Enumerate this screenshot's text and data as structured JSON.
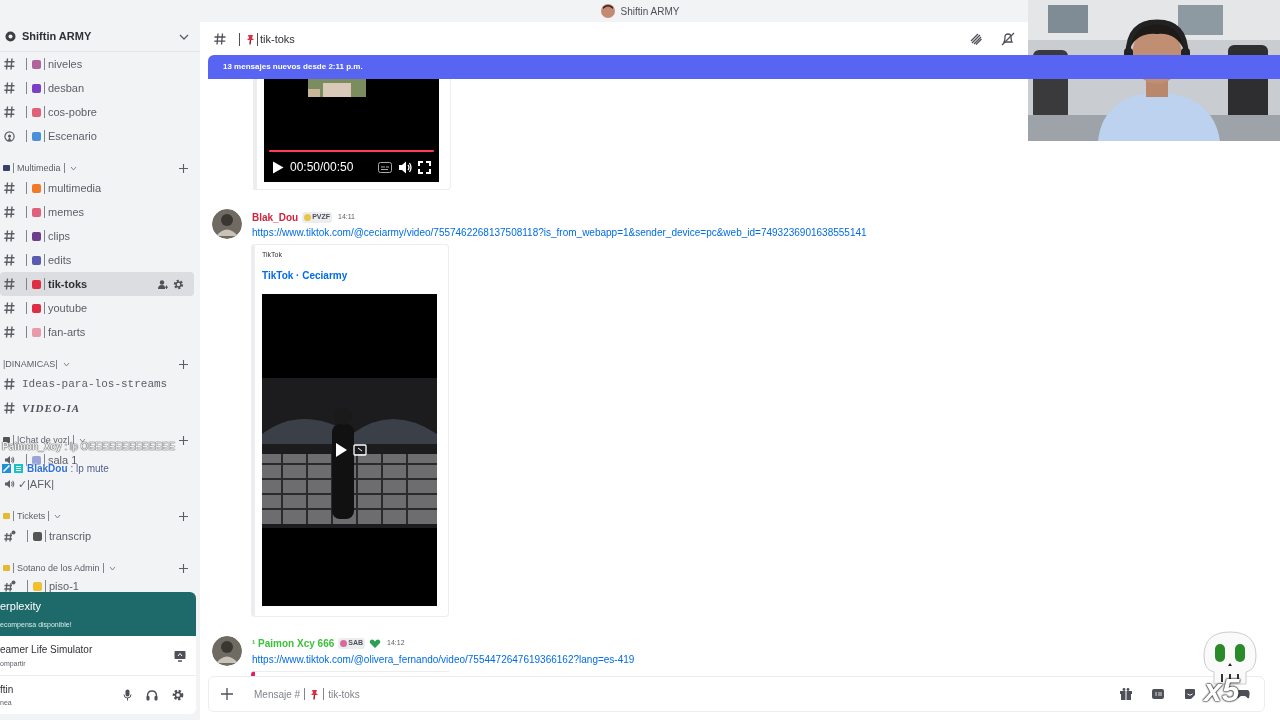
{
  "window": {
    "title": "Shiftin ARMY"
  },
  "server": {
    "name": "Shiftin ARMY"
  },
  "sidebar": {
    "items": [
      {
        "kind": "text",
        "label": "niveles",
        "color": "#b0649c",
        "selected": false
      },
      {
        "kind": "text",
        "label": "desban",
        "color": "#7a3fc4",
        "selected": false
      },
      {
        "kind": "text",
        "label": "cos-pobre",
        "color": "#e0607a",
        "selected": false
      },
      {
        "kind": "stage",
        "label": "Escenario",
        "color": "#4a90d9",
        "selected": false
      },
      {
        "kind": "category",
        "label": "Multimedia",
        "color": "#3b3f6b"
      },
      {
        "kind": "text",
        "label": "multimedia",
        "color": "#f07a2a",
        "selected": false
      },
      {
        "kind": "text",
        "label": "memes",
        "color": "#e0607a",
        "selected": false
      },
      {
        "kind": "text",
        "label": "clips",
        "color": "#6b3f8c",
        "selected": false
      },
      {
        "kind": "text",
        "label": "edits",
        "color": "#5a5ab0",
        "selected": false
      },
      {
        "kind": "text",
        "label": "tik-toks",
        "color": "#dd2e44",
        "selected": true
      },
      {
        "kind": "text",
        "label": "youtube",
        "color": "#dd2e44",
        "selected": false
      },
      {
        "kind": "text",
        "label": "fan-arts",
        "color": "#e89aa8",
        "selected": false
      },
      {
        "kind": "category",
        "label": "|DINAMICAS|"
      },
      {
        "kind": "mono",
        "label": "Ideas-para-los-streams",
        "selected": false
      },
      {
        "kind": "fancy",
        "label": "VIDEO-IA",
        "selected": false
      },
      {
        "kind": "category",
        "label": "|Chat de voz|",
        "color": "#555555"
      },
      {
        "kind": "voice",
        "label": "sala 1",
        "color": "#9aa4d8",
        "selected": false
      },
      {
        "kind": "voice_plain",
        "label": "✓|AFK|",
        "selected": false
      },
      {
        "kind": "category",
        "label": "Tickets",
        "color": "#e8b830"
      },
      {
        "kind": "locked",
        "label": "transcrip",
        "color": "#555555",
        "selected": false
      },
      {
        "kind": "category",
        "label": "Sotano de los Admin",
        "color": "#e8b830"
      },
      {
        "kind": "locked",
        "label": "piso-1",
        "color": "#f0c030",
        "selected": false
      }
    ]
  },
  "promo": {
    "title": "erplexity",
    "subtitle": "ecompensa disponible!"
  },
  "activity": {
    "title": "eamer Life Simulator",
    "subtitle": "ompartir"
  },
  "user": {
    "name": "ftin",
    "status": "nea"
  },
  "channel_header": {
    "name": "tik-toks"
  },
  "new_messages_banner": "13 mensajes nuevos desde 2:11 p.m.",
  "messages": [
    {
      "kind": "embed_continuation",
      "video_time": "00:50/00:50"
    },
    {
      "kind": "message",
      "author": "Blak_Dou",
      "color": "#d0243f",
      "badge": "PVZF",
      "time": "14:11",
      "link": "https://www.tiktok.com/@ceciarmy/video/7557462268137508118?is_from_webapp=1&sender_device=pc&web_id=7493236901638555141",
      "embed": {
        "provider": "TikTok",
        "title": "TikTok · Ceciarmy"
      }
    },
    {
      "kind": "message",
      "author": "¹ Paimon Xcy 666",
      "color": "#3cc13c",
      "badge": "SAB",
      "time": "14:12",
      "link": "https://www.tiktok.com/@olivera_fernando/video/7554472647619366162?lang=es-419"
    }
  ],
  "composer": {
    "placeholder_start": "Mensaje #",
    "placeholder_end": "tik-toks"
  },
  "stream_overlay": {
    "chat": [
      {
        "user": "Paimon_Xcy",
        "text": ": lp OEEEEEEEEEEEEE",
        "highlight": false
      },
      {
        "user": "BlakDou",
        "text": ": lp mute",
        "highlight": true
      }
    ],
    "sticker": "x5"
  }
}
